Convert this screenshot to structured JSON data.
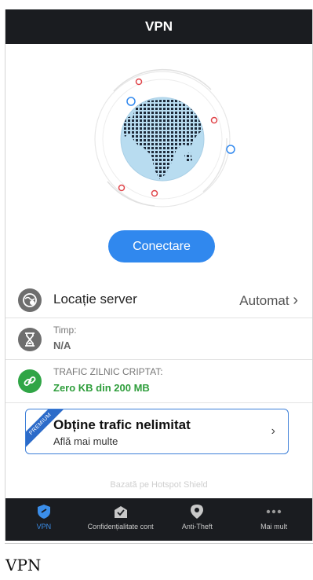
{
  "header": {
    "title": "VPN"
  },
  "hero": {
    "connect_label": "Conectare"
  },
  "server": {
    "label": "Locație server",
    "value": "Automat",
    "chevron": "›"
  },
  "time": {
    "label": "Timp:",
    "value": "N/A"
  },
  "traffic": {
    "label": "TRAFIC ZILNIC CRIPTAT:",
    "value": "Zero KB din 200 MB"
  },
  "promo": {
    "badge": "PREMIUM",
    "title": "Obține trafic nelimitat",
    "subtitle": "Află mai multe",
    "chevron": "›"
  },
  "powered_by": "Bazată pe Hotspot Shield",
  "tabs": [
    {
      "label": "VPN",
      "icon": "shield-icon",
      "active": true
    },
    {
      "label": "Confidențialitate cont",
      "icon": "envelope-check-icon",
      "active": false
    },
    {
      "label": "Anti-Theft",
      "icon": "location-pin-icon",
      "active": false
    },
    {
      "label": "Mai mult",
      "icon": "more-dots-icon",
      "active": false
    }
  ],
  "page_caption": "VPN",
  "colors": {
    "accent": "#3088ee",
    "header": "#1a1c20",
    "green": "#30a546",
    "premium": "#2c6bc9"
  }
}
